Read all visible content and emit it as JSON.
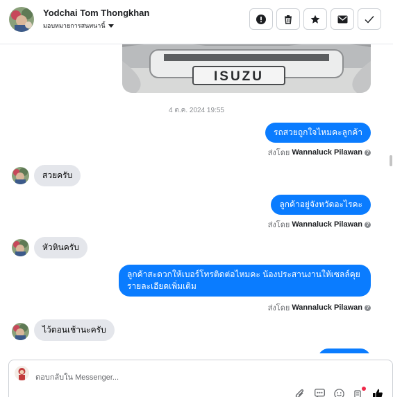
{
  "header": {
    "contact_name": "Yodchai Tom Thongkhan",
    "assign_label": "มอบหมายการสนทนานี้",
    "actions": [
      {
        "name": "spam-report-button",
        "icon": "alert-icon"
      },
      {
        "name": "delete-button",
        "icon": "trash-icon"
      },
      {
        "name": "star-button",
        "icon": "star-icon"
      },
      {
        "name": "mark-unread-button",
        "icon": "mail-icon"
      },
      {
        "name": "mark-done-button",
        "icon": "check-icon"
      }
    ]
  },
  "conversation": {
    "timestamp": "4 ต.ค. 2024 19:55",
    "image_caption": "ISUZU",
    "sent_by_prefix": "ส่งโดย",
    "messages": [
      {
        "direction": "out",
        "text": "รถสวยถูกใจไหมคะลูกค้า",
        "sender": "Wannaluck Pilawan"
      },
      {
        "direction": "in",
        "text": "สวยครับ"
      },
      {
        "direction": "out",
        "text": "ลูกค้าอยู่จังหวัดอะไรคะ",
        "sender": "Wannaluck Pilawan"
      },
      {
        "direction": "in",
        "text": "หัวหินครับ"
      },
      {
        "direction": "out",
        "text_line1": "ลูกค้าสะดวกให้เบอร์โทรติดต่อไหมคะ  น้องประสานงานให้เซลล์คุย",
        "text_line2": "รายละเอียดเพิ่มเติม",
        "sender": "Wannaluck Pilawan"
      },
      {
        "direction": "in",
        "text": "ไว้ตอนเช้านะครับ"
      }
    ]
  },
  "composer": {
    "placeholder": "ตอบกลับใน Messenger..."
  },
  "colors": {
    "outgoing_bubble": "#0a7cff",
    "incoming_bubble": "#e4e6eb",
    "notification_dot": "#f02849"
  }
}
